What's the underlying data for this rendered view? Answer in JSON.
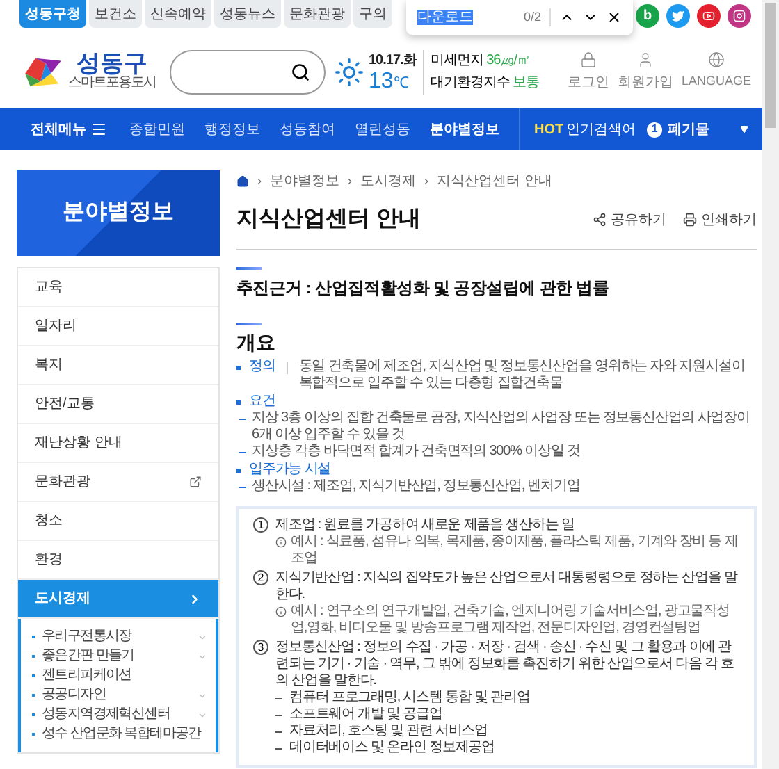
{
  "top_tabs": [
    {
      "label": "성동구청",
      "selected": true
    },
    {
      "label": "보건소",
      "selected": false
    },
    {
      "label": "신속예약",
      "selected": false
    },
    {
      "label": "성동뉴스",
      "selected": false
    },
    {
      "label": "문화관광",
      "selected": false
    },
    {
      "label": "구의",
      "selected": false
    }
  ],
  "find_bar": {
    "value": "다운로드",
    "count": "0/2"
  },
  "social": [
    {
      "kind": "blog",
      "label": "b"
    },
    {
      "kind": "twitter"
    },
    {
      "kind": "youtube"
    },
    {
      "kind": "instagram"
    }
  ],
  "logo": {
    "name": "성동구",
    "slogan": "스마트포용도시"
  },
  "weather": {
    "date": "10.17.화",
    "temp": "13",
    "unit": "℃",
    "dust_label": "미세먼지",
    "dust_value": "36㎍/㎥",
    "air_label": "대기환경지수",
    "air_value": "보통"
  },
  "user_links": [
    {
      "kind": "login",
      "label": "로그인"
    },
    {
      "kind": "join",
      "label": "회원가입"
    },
    {
      "kind": "language",
      "label": "LANGUAGE"
    }
  ],
  "nav": {
    "all_menu": "전체메뉴",
    "items": [
      {
        "label": "종합민원",
        "selected": false
      },
      {
        "label": "행정정보",
        "selected": false
      },
      {
        "label": "성동참여",
        "selected": false
      },
      {
        "label": "열린성동",
        "selected": false
      },
      {
        "label": "분야별정보",
        "selected": true
      }
    ],
    "hot_label": "HOT",
    "hot_title": "인기검색어",
    "hot_rank": "1",
    "hot_keyword": "폐기물"
  },
  "sidebar": {
    "title": "분야별정보",
    "items": [
      {
        "label": "교육",
        "selected": false,
        "external": false
      },
      {
        "label": "일자리",
        "selected": false,
        "external": false
      },
      {
        "label": "복지",
        "selected": false,
        "external": false
      },
      {
        "label": "안전/교통",
        "selected": false,
        "external": false
      },
      {
        "label": "재난상황 안내",
        "selected": false,
        "external": false
      },
      {
        "label": "문화관광",
        "selected": false,
        "external": true
      },
      {
        "label": "청소",
        "selected": false,
        "external": false
      },
      {
        "label": "환경",
        "selected": false,
        "external": false
      },
      {
        "label": "도시경제",
        "selected": true,
        "external": false,
        "children": [
          {
            "label": "우리구전통시장",
            "has_submenu": true
          },
          {
            "label": "좋은간판 만들기",
            "has_submenu": true
          },
          {
            "label": "젠트리피케이션",
            "has_submenu": false
          },
          {
            "label": "공공디자인",
            "has_submenu": true
          },
          {
            "label": "성동지역경제혁신센터",
            "has_submenu": true
          },
          {
            "label": "성수 산업문화 복합테마공간",
            "has_submenu": false
          }
        ]
      }
    ]
  },
  "content": {
    "breadcrumb": [
      "분야별정보",
      "도시경제",
      "지식산업센터 안내"
    ],
    "title": "지식산업센터 안내",
    "actions": [
      {
        "kind": "share",
        "label": "공유하기"
      },
      {
        "kind": "print",
        "label": "인쇄하기"
      }
    ],
    "basis": "추진근거 : 산업집적활성화 및 공장설립에 관한 법률",
    "overview_heading": "개요",
    "overview": [
      {
        "label": "정의",
        "text": "동일 건축물에 제조업, 지식산업 및 정보통신산업을 영위하는 자와 지원시설이 복합적으로 입주할 수 있는 다층형 집합건축물"
      },
      {
        "label": "요건",
        "subitems": [
          "지상 3층 이상의 집합 건축물로 공장, 지식산업의 사업장 또는 정보통신산업의 사업장이 6개 이상 입주할 수 있을 것",
          "지상층 각층 바닥면적 합계가 건축면적의 300% 이상일 것"
        ]
      },
      {
        "label": "입주가능 시설",
        "subitems": [
          "생산시설 : 제조업, 지식기반산업, 정보통신산업, 벤처기업"
        ]
      }
    ],
    "box_items": [
      {
        "number": "1",
        "text": "제조업 : 원료를 가공하여 새로운 제품을 생산하는 일",
        "note": "예시 : 식료품, 섬유나 의복, 목제품, 종이제품, 플라스틱 제품, 기계와 장비 등 제조업"
      },
      {
        "number": "2",
        "text": "지식기반산업 : 지식의 집약도가 높은 산업으로서 대통령령으로 정하는 산업을 말한다.",
        "note": "예시 : 연구소의 연구개발업, 건축기술, 엔지니어링 기술서비스업, 광고물작성업,영화, 비디오물 및 방송프로그램 제작업, 전문디자인업, 경영컨설팅업"
      },
      {
        "number": "3",
        "text": "정보통신산업 : 정보의 수집 · 가공 · 저장 · 검색 · 송신 · 수신 및 그 활용과 이에 관련되는 기기 · 기술 · 역무, 그 밖에 정보화를 촉진하기 위한 산업으로서 다음 각 호의 산업을 말한다.",
        "subitems": [
          "컴퓨터 프로그래밍, 시스템 통합 및 관리업",
          "소프트웨어 개발 및 공급업",
          "자료처리, 호스팅 및 관련 서비스업",
          "데이터베이스 및 온라인 정보제공업"
        ]
      }
    ]
  }
}
